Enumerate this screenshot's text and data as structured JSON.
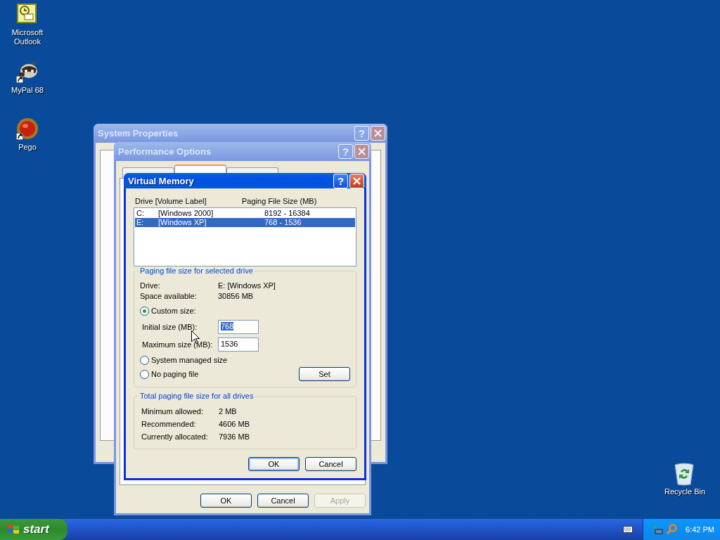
{
  "desktop_icons": [
    {
      "label": "Microsoft Outlook",
      "kind": "mail",
      "shortcut": false
    },
    {
      "label": "MyPal 68",
      "kind": "raccoon",
      "shortcut": true
    },
    {
      "label": "Pego",
      "kind": "ball",
      "shortcut": true
    },
    {
      "label": "Recycle Bin",
      "kind": "bin",
      "shortcut": false
    }
  ],
  "system_properties": {
    "title": "System Properties",
    "help": "?",
    "active": false
  },
  "performance_options": {
    "title": "Performance Options",
    "help": "?",
    "active": false,
    "tabs": [
      {
        "selected": false
      },
      {
        "selected": true
      },
      {
        "selected": false
      }
    ],
    "buttons": [
      {
        "label": "OK",
        "disabled": false
      },
      {
        "label": "Cancel",
        "disabled": false
      },
      {
        "label": "Apply",
        "disabled": true
      }
    ]
  },
  "virtual_memory": {
    "title": "Virtual Memory",
    "help": "?",
    "active": true,
    "list_columns": [
      "Drive  [Volume Label]",
      "Paging File Size (MB)"
    ],
    "drives": [
      {
        "drive": "C:",
        "label": "[Windows 2000]",
        "size": "8192 - 16384",
        "selected": false
      },
      {
        "drive": "E:",
        "label": "[Windows XP]",
        "size": "768 - 1536",
        "selected": true
      }
    ],
    "selected_drive_group": {
      "title": "Paging file size for selected drive",
      "info": [
        {
          "label": "Drive:",
          "value": "E:  [Windows XP]"
        },
        {
          "label": "Space available:",
          "value": "30856 MB"
        }
      ],
      "radios": [
        {
          "label": "Custom size:",
          "selected": true
        },
        {
          "label": "System managed size",
          "selected": false
        },
        {
          "label": "No paging file",
          "selected": false
        }
      ],
      "fields": [
        {
          "label": "Initial size (MB):",
          "value": "768",
          "highlighted": true
        },
        {
          "label": "Maximum size (MB):",
          "value": "1536",
          "highlighted": false
        }
      ],
      "set_button": "Set"
    },
    "total_group": {
      "title": "Total paging file size for all drives",
      "info": [
        {
          "label": "Minimum allowed:",
          "value": "2 MB"
        },
        {
          "label": "Recommended:",
          "value": "4606 MB"
        },
        {
          "label": "Currently allocated:",
          "value": "7936 MB"
        }
      ]
    },
    "buttons": [
      {
        "label": "OK",
        "default": true
      },
      {
        "label": "Cancel",
        "default": false
      }
    ]
  },
  "taskbar": {
    "start": "start",
    "clock": "6:42 PM"
  }
}
